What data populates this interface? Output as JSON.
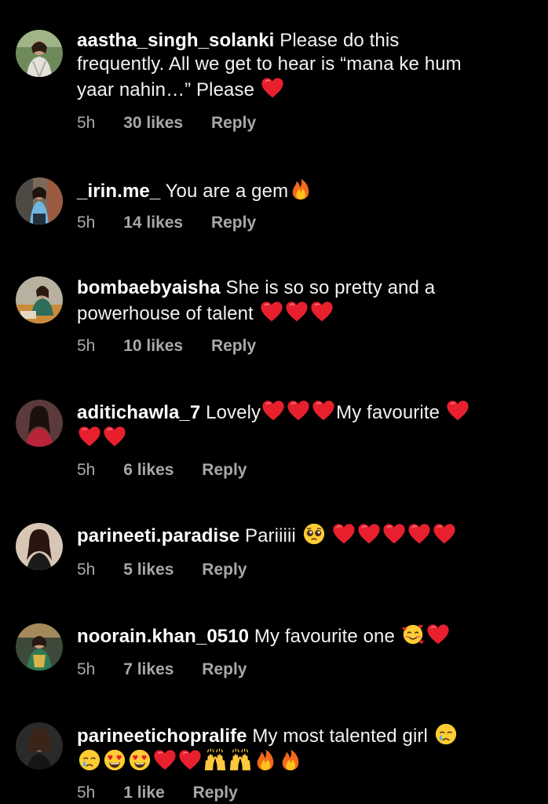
{
  "colors": {
    "background": "#000000",
    "text": "#f2f2f2",
    "meta": "#a8a8a8",
    "heart": "#e8202e"
  },
  "comments": [
    {
      "username": "aastha_singh_solanki",
      "text_lines": [
        "Please do this",
        "frequently. All we get to hear is “mana ke hum",
        "yaar nahin…” Please"
      ],
      "emojis_end": [
        "red-heart"
      ],
      "time": "5h",
      "likes": "30 likes",
      "reply": "Reply",
      "avatar": "avatar-aastha"
    },
    {
      "username": "_irin.me_",
      "text": "You are a gem",
      "emojis_end": [
        "fire"
      ],
      "time": "5h",
      "likes": "14 likes",
      "reply": "Reply",
      "avatar": "avatar-irin"
    },
    {
      "username": "bombaebyaisha",
      "text_line1": "She is so so pretty and a",
      "text_line2": "powerhouse of talent",
      "emojis_end": [
        "red-heart",
        "red-heart",
        "red-heart"
      ],
      "time": "5h",
      "likes": "10 likes",
      "reply": "Reply",
      "avatar": "avatar-bombaebyaisha"
    },
    {
      "username": "aditichawla_7",
      "text_a": "Lovely",
      "text_b": "My favourite",
      "time": "5h",
      "likes": "6 likes",
      "reply": "Reply",
      "avatar": "avatar-aditichawla"
    },
    {
      "username": "parineeti.paradise",
      "text": "Pariiiii",
      "time": "5h",
      "likes": "5 likes",
      "reply": "Reply",
      "avatar": "avatar-parineeti-paradise"
    },
    {
      "username": "noorain.khan_0510",
      "text": "My favourite one",
      "time": "5h",
      "likes": "7 likes",
      "reply": "Reply",
      "avatar": "avatar-noorain"
    },
    {
      "username": "parineetichopralife",
      "text": "My most talented girl",
      "time": "5h",
      "likes": "1 like",
      "reply": "Reply",
      "avatar": "avatar-parineetichopralife"
    }
  ]
}
